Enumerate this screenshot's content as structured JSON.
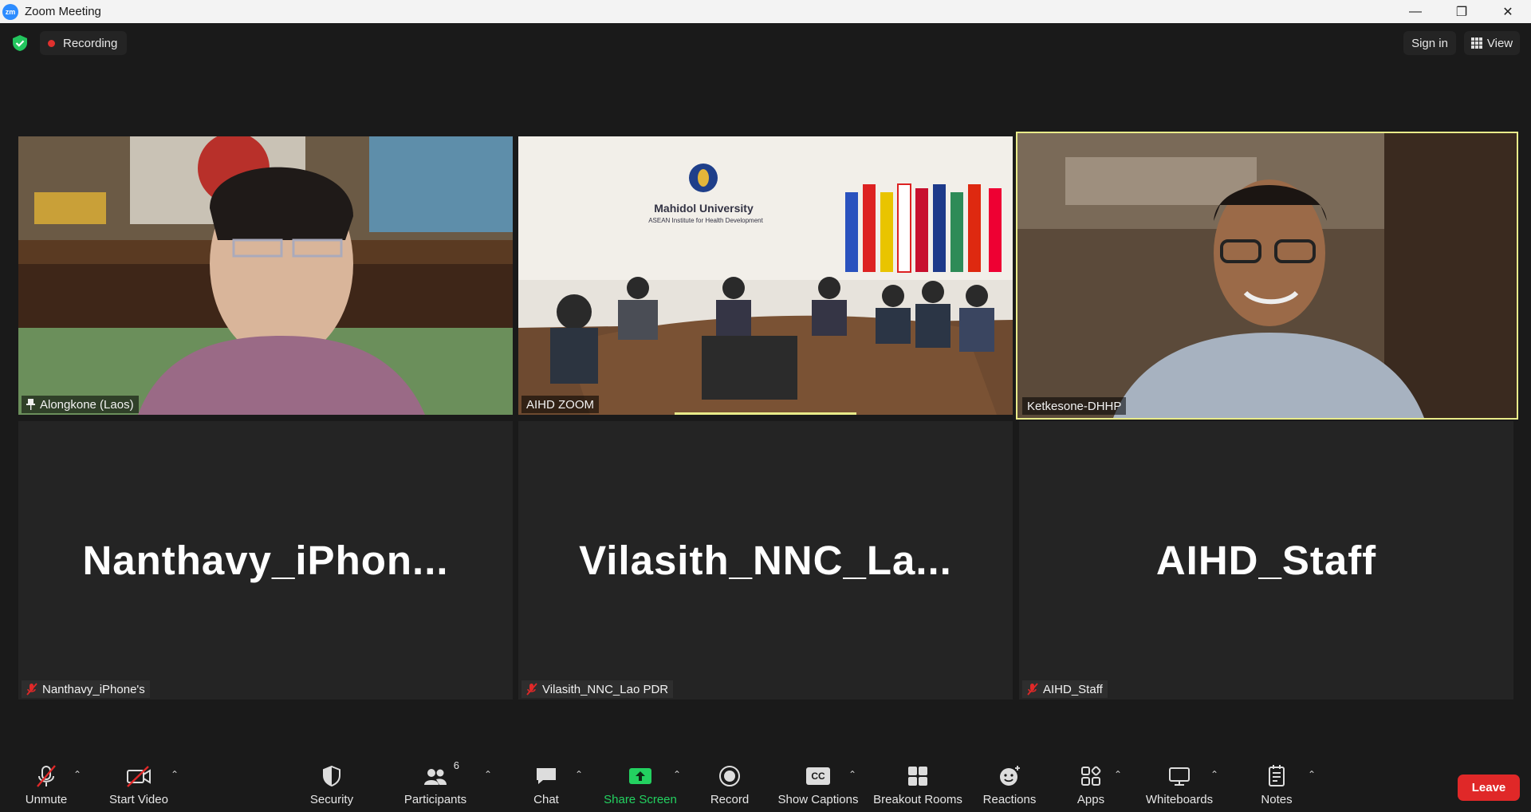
{
  "window": {
    "logo_text": "zm",
    "title": "Zoom Meeting",
    "minimize": "—",
    "restore": "❐",
    "close": "✕"
  },
  "topbar": {
    "recording_label": "Recording",
    "signin_label": "Sign in",
    "view_label": "View",
    "colors": {
      "recording_dot": "#e0312e",
      "shield": "#23c55e"
    }
  },
  "tiles": [
    {
      "name": "Alongkone (Laos)",
      "video": true,
      "pinned": true
    },
    {
      "name": "AIHD ZOOM",
      "video": true,
      "scene_text_1": "Mahidol University",
      "scene_text_2": "ASEAN Institute for Health Development"
    },
    {
      "name": "Ketkesone-DHHP",
      "video": true,
      "active_speaker": true
    },
    {
      "name": "Nanthavy_iPhone's",
      "big_name": "Nanthavy_iPhon...",
      "video": false,
      "muted": true
    },
    {
      "name": "Vilasith_NNC_Lao PDR",
      "big_name": "Vilasith_NNC_La...",
      "video": false,
      "muted": true
    },
    {
      "name": "AIHD_Staff",
      "big_name": "AIHD_Staff",
      "video": false,
      "muted": true
    }
  ],
  "toolbar": {
    "unmute": "Unmute",
    "start_video": "Start Video",
    "security": "Security",
    "participants": "Participants",
    "participants_count": "6",
    "chat": "Chat",
    "share_screen": "Share Screen",
    "record": "Record",
    "show_captions": "Show Captions",
    "cc_text": "CC",
    "breakout_rooms": "Breakout Rooms",
    "reactions": "Reactions",
    "apps": "Apps",
    "whiteboards": "Whiteboards",
    "notes": "Notes",
    "leave": "Leave",
    "colors": {
      "share_green": "#23d160",
      "leave_red": "#e02828",
      "muted_red": "#e02828"
    }
  }
}
